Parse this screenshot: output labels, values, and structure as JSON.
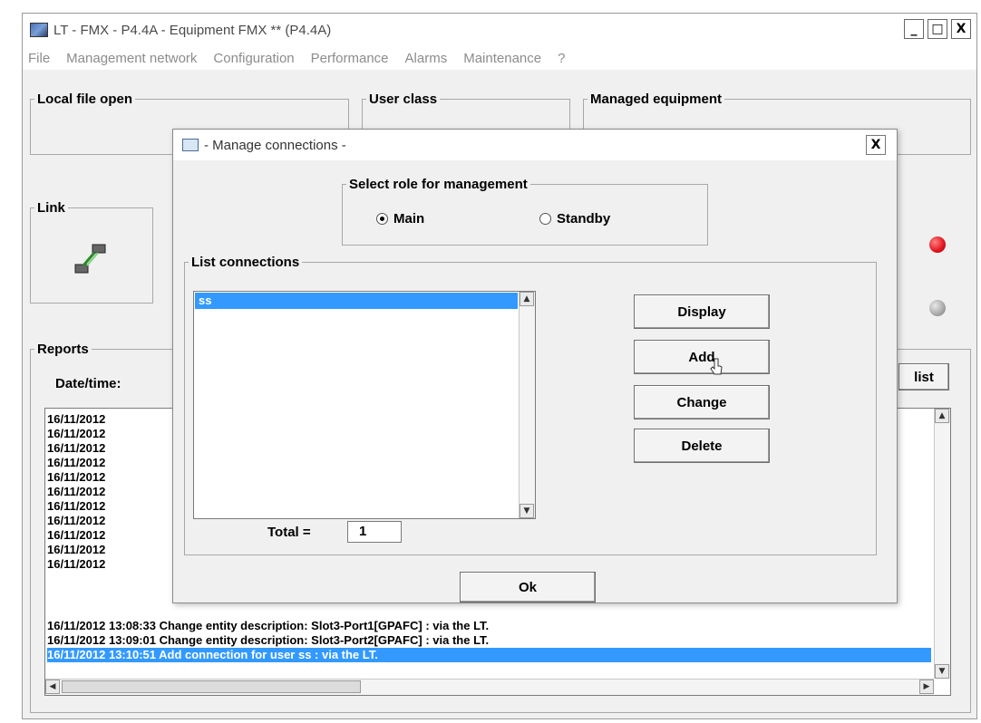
{
  "window": {
    "title": "LT - FMX - P4.4A - Equipment FMX ** (P4.4A)",
    "controls": {
      "minimize": "_",
      "maximize": "□",
      "close": "X"
    }
  },
  "menubar": {
    "items": [
      "File",
      "Management network",
      "Configuration",
      "Performance",
      "Alarms",
      "Maintenance",
      "?"
    ]
  },
  "groups": {
    "local_file_open": "Local file open",
    "user_class": "User class",
    "managed_equipment": "Managed equipment",
    "link": "Link",
    "reports": "Reports"
  },
  "reports": {
    "date_time_label": "Date/time:",
    "list_button_label": "list",
    "rows": [
      "16/11/2012",
      "16/11/2012",
      "16/11/2012",
      "16/11/2012",
      "16/11/2012",
      "16/11/2012",
      "16/11/2012",
      "16/11/2012",
      "16/11/2012",
      "16/11/2012",
      "16/11/2012",
      "16/11/2012   13:08:33   Change entity description: Slot3-Port1[GPAFC] : via the LT.",
      "16/11/2012   13:09:01   Change entity description: Slot3-Port2[GPAFC] : via the LT.",
      "16/11/2012   13:10:51   Add connection for user ss : via the LT."
    ],
    "selected_row_index": 13
  },
  "status_colors": {
    "active": "#e0141e",
    "inactive": "#a8a8a8"
  },
  "dialog": {
    "title": "- Manage connections -",
    "close_label": "X",
    "role_group_label": "Select role for management",
    "roles": [
      {
        "label": "Main",
        "checked": true
      },
      {
        "label": "Standby",
        "checked": false
      }
    ],
    "connections_group_label": "List connections",
    "connections": [
      "ss"
    ],
    "total_label": "Total =",
    "total_value": "1",
    "buttons": {
      "display": "Display",
      "add": "Add",
      "change": "Change",
      "delete": "Delete",
      "ok": "Ok"
    }
  },
  "icons": {
    "app": "app-icon",
    "link": "network-link-icon",
    "cursor": "mouse-pointer-icon"
  },
  "colors": {
    "selection": "#3399ff"
  }
}
